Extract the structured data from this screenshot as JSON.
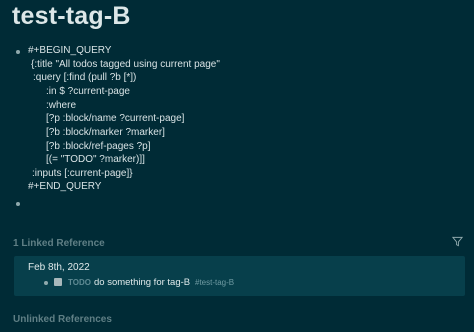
{
  "page": {
    "title": "test-tag-B"
  },
  "block": {
    "lines": [
      "#+BEGIN_QUERY",
      "{:title \"All todos tagged using current page\"",
      ":query [:find (pull ?b [*])",
      ":in $ ?current-page",
      ":where",
      "[?p :block/name ?current-page]",
      "[?b :block/marker ?marker]",
      "[?b :block/ref-pages ?p]",
      "[(= \"TODO\" ?marker)]]",
      ":inputs [:current-page]}",
      "#+END_QUERY"
    ]
  },
  "linked_references": {
    "header": "1 Linked Reference",
    "filter_icon": "filter-icon",
    "items": [
      {
        "date": "Feb 8th, 2022",
        "marker": "TODO",
        "text": "do something for tag-B",
        "tag": "#test-tag-B"
      }
    ]
  },
  "unlinked_references": {
    "header": "Unlinked References"
  },
  "colors": {
    "background": "#002b36",
    "card": "#073f4b",
    "muted": "#5f7f85"
  }
}
